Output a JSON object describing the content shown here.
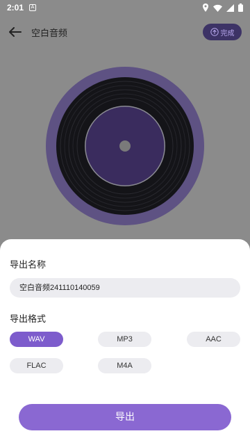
{
  "status_bar": {
    "time": "2:01"
  },
  "header": {
    "title": "空白音频",
    "done_label": "完成"
  },
  "sheet": {
    "name_section_title": "导出名称",
    "name_value": "空白音频241110140059",
    "format_section_title": "导出格式",
    "formats": [
      {
        "label": "WAV",
        "selected": true
      },
      {
        "label": "MP3",
        "selected": false
      },
      {
        "label": "AAC",
        "selected": false
      },
      {
        "label": "FLAC",
        "selected": false
      },
      {
        "label": "M4A",
        "selected": false
      }
    ],
    "export_label": "导出"
  },
  "colors": {
    "accent": "#8a68d2",
    "selected_format": "#7d5ccc",
    "vinyl_ring": "#5e5283",
    "vinyl_label": "#3a2c5e"
  }
}
